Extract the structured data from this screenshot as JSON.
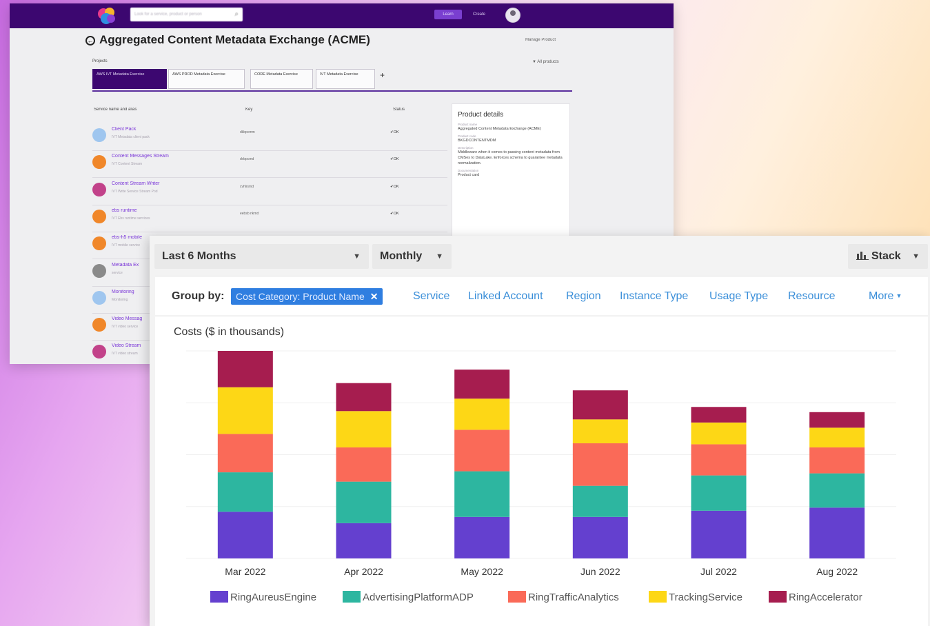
{
  "back": {
    "search_placeholder": "Look for a service, product or person",
    "nav_btn_primary": "Learn",
    "nav_btn_secondary": "Create",
    "page_title": "Aggregated Content Metadata Exchange (ACME)",
    "manage_label": "Manage Product",
    "projects_label": "Projects",
    "all_products_label": "All products",
    "tabs": [
      "AWS IVT Metadata Exercise",
      "AWS PROD Metadata Exercise",
      "CORE Metadata Exercise",
      "IVT Metadata Exercise"
    ],
    "tab_add": "+",
    "columns": [
      "Service name and alias",
      "Key",
      "Status"
    ],
    "services": [
      {
        "name": "Client Pack",
        "sub": "IVT Metadata client pack",
        "key": "dkbpcmm",
        "status": "OK",
        "color": "#9fc6ef"
      },
      {
        "name": "Content Messages Stream",
        "sub": "IVT Content Stream",
        "key": "dvbpcmd",
        "status": "OK",
        "color": "#f0872a"
      },
      {
        "name": "Content Stream Writer",
        "sub": "IVT Write Service Stream Pod",
        "key": "cvhlrsmd",
        "status": "OK",
        "color": "#c2428a"
      },
      {
        "name": "ebs runtime",
        "sub": "IVT Ebs runtime services",
        "key": "eebsb nkmd",
        "status": "OK",
        "color": "#f0872a"
      },
      {
        "name": "ebs-h5 mobile",
        "sub": "IVT mobile service",
        "key": "",
        "status": "",
        "color": "#f0872a"
      },
      {
        "name": "Metadata Ex",
        "sub": "service",
        "key": "",
        "status": "",
        "color": "#8a8a8a"
      },
      {
        "name": "Monitoring",
        "sub": "Monitoring",
        "key": "",
        "status": "",
        "color": "#9fc6ef"
      },
      {
        "name": "Video Messag",
        "sub": "IVT video service",
        "key": "",
        "status": "",
        "color": "#f0872a"
      },
      {
        "name": "Video Stream",
        "sub": "IVT video stream",
        "key": "",
        "status": "",
        "color": "#c2428a"
      }
    ],
    "details": {
      "heading": "Product details",
      "fields": [
        {
          "label": "Product name",
          "value": "Aggregated Content Metadata Exchange (ACME)"
        },
        {
          "label": "Product code",
          "value": "BKGDCONTENTMDM"
        },
        {
          "label": "Description",
          "value": "Middleware when it comes to passing content metadata from CMSes to DataLake. Enforces schema to guarantee metadata normalization."
        },
        {
          "label": "Documentation",
          "value": "Product card"
        }
      ]
    }
  },
  "controls": {
    "range_label": "Last 6 Months",
    "granularity_label": "Monthly",
    "stack_label": "Stack"
  },
  "groupby": {
    "label": "Group by:",
    "active_chip": "Cost Category: Product Name",
    "links": [
      "Service",
      "Linked Account",
      "Region",
      "Instance Type",
      "Usage Type",
      "Resource"
    ],
    "more_label": "More"
  },
  "chart_data": {
    "type": "bar",
    "stacked": true,
    "ylabel": "Costs ($ in thousands)",
    "categories": [
      "Mar 2022",
      "Apr 2022",
      "May 2022",
      "Jun 2022",
      "Jul 2022",
      "Aug 2022"
    ],
    "ylim": [
      0,
      100
    ],
    "grid": true,
    "legend_position": "bottom",
    "series": [
      {
        "name": "RingAureusEngine",
        "color": "#6440cf",
        "values": [
          22.5,
          17,
          20,
          20,
          23,
          24.5
        ]
      },
      {
        "name": "AdvertisingPlatformADP",
        "color": "#2db6a0",
        "values": [
          19,
          20,
          22,
          15,
          17,
          16.5
        ]
      },
      {
        "name": "RingTrafficAnalytics",
        "color": "#fa6a58",
        "values": [
          18.5,
          16.5,
          20,
          20.5,
          15,
          12.5
        ]
      },
      {
        "name": "TrackingService",
        "color": "#fdd716",
        "values": [
          22.5,
          17.5,
          15,
          11.5,
          10.5,
          9.5
        ]
      },
      {
        "name": "RingAccelerator",
        "color": "#a61d4f",
        "values": [
          17.5,
          13.5,
          14,
          14,
          7.5,
          7.5
        ]
      }
    ]
  }
}
